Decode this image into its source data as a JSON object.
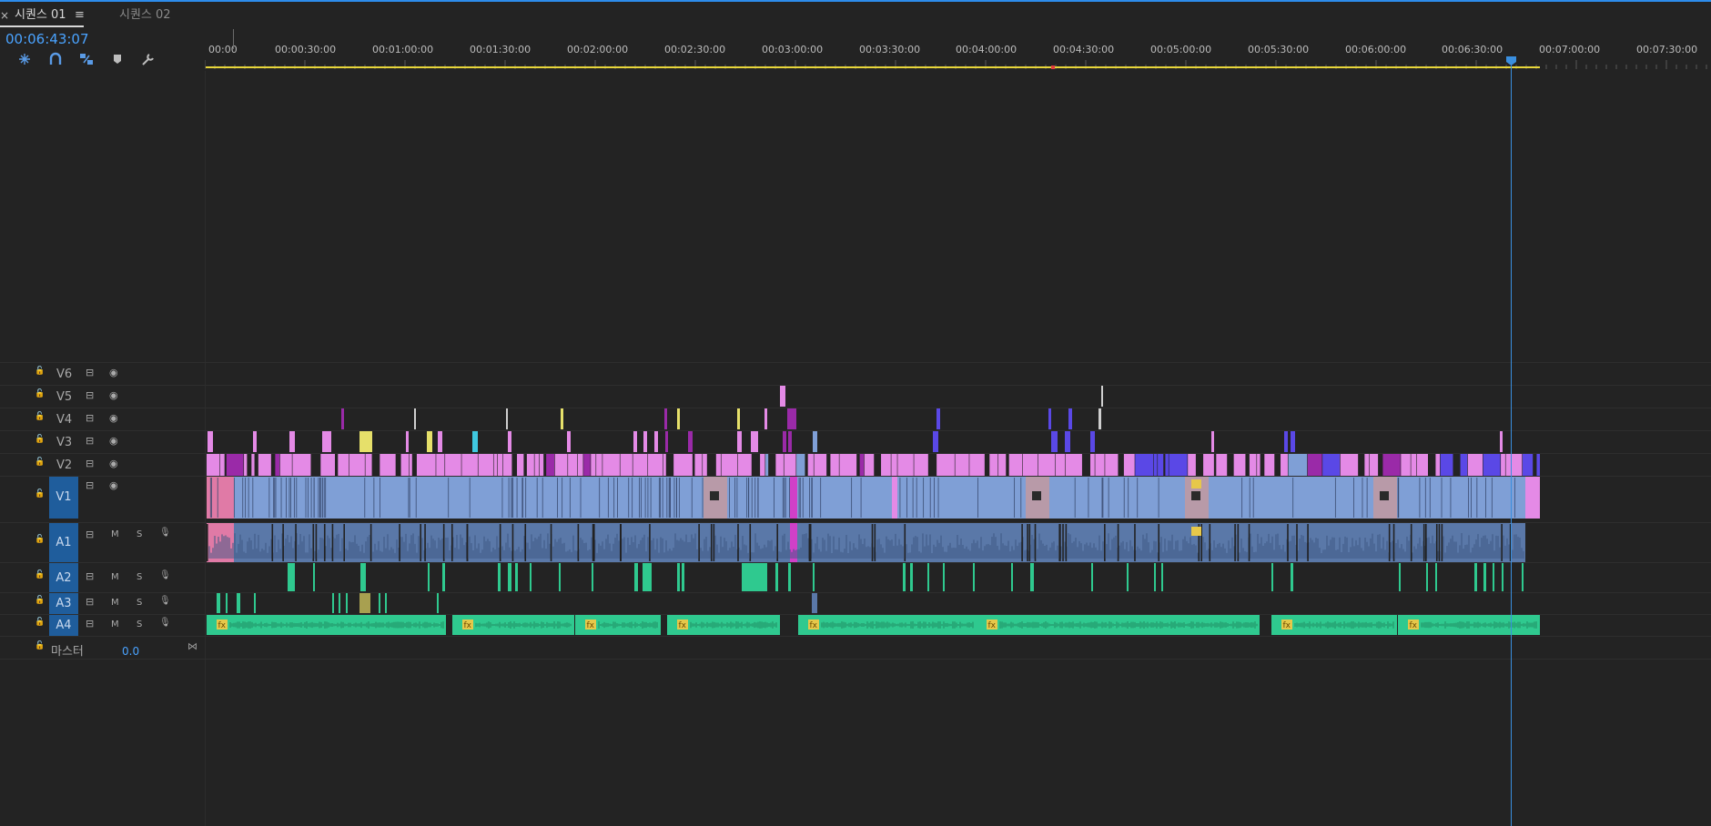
{
  "tabs": {
    "close_glyph": "×",
    "sequence_1": "시퀀스 01",
    "menu_glyph": "≡",
    "sequence_2": "시퀀스 02"
  },
  "timecode": "00:06:43:07",
  "tools": [
    "snap-icon",
    "magnet-icon",
    "linked-selection-icon",
    "marker-icon",
    "wrench-icon"
  ],
  "ruler": {
    "labels": [
      "00:00",
      "00:00:30:00",
      "00:01:00:00",
      "00:01:30:00",
      "00:02:00:00",
      "00:02:30:00",
      "00:03:00:00",
      "00:03:30:00",
      "00:04:00:00",
      "00:04:30:00",
      "00:05:00:00",
      "00:05:30:00",
      "00:06:00:00",
      "00:06:30:00",
      "00:07:00:00",
      "00:07:30:00"
    ]
  },
  "video_tracks": [
    "V6",
    "V5",
    "V4",
    "V3",
    "V2",
    "V1"
  ],
  "audio_tracks": [
    "A1",
    "A2",
    "A3",
    "A4"
  ],
  "mute_label": "M",
  "solo_label": "S",
  "master": {
    "label": "마스터",
    "value": "0.0"
  },
  "colors": {
    "background": "#232323",
    "timecode_blue": "#4aa3ff",
    "playhead": "#3a8fdf",
    "work_area": "#e8d63a",
    "clip_video_blue": "#7f9fd6",
    "clip_pink": "#e48ae6",
    "clip_purple": "#9a2aa8",
    "clip_violet": "#5a48e6",
    "clip_yellow": "#e6e06a",
    "clip_cyan": "#3fc8e0",
    "clip_audio_green": "#2fc98f",
    "clip_audio_blue": "#5a78a8",
    "track_selected": "#1f5d9c"
  }
}
